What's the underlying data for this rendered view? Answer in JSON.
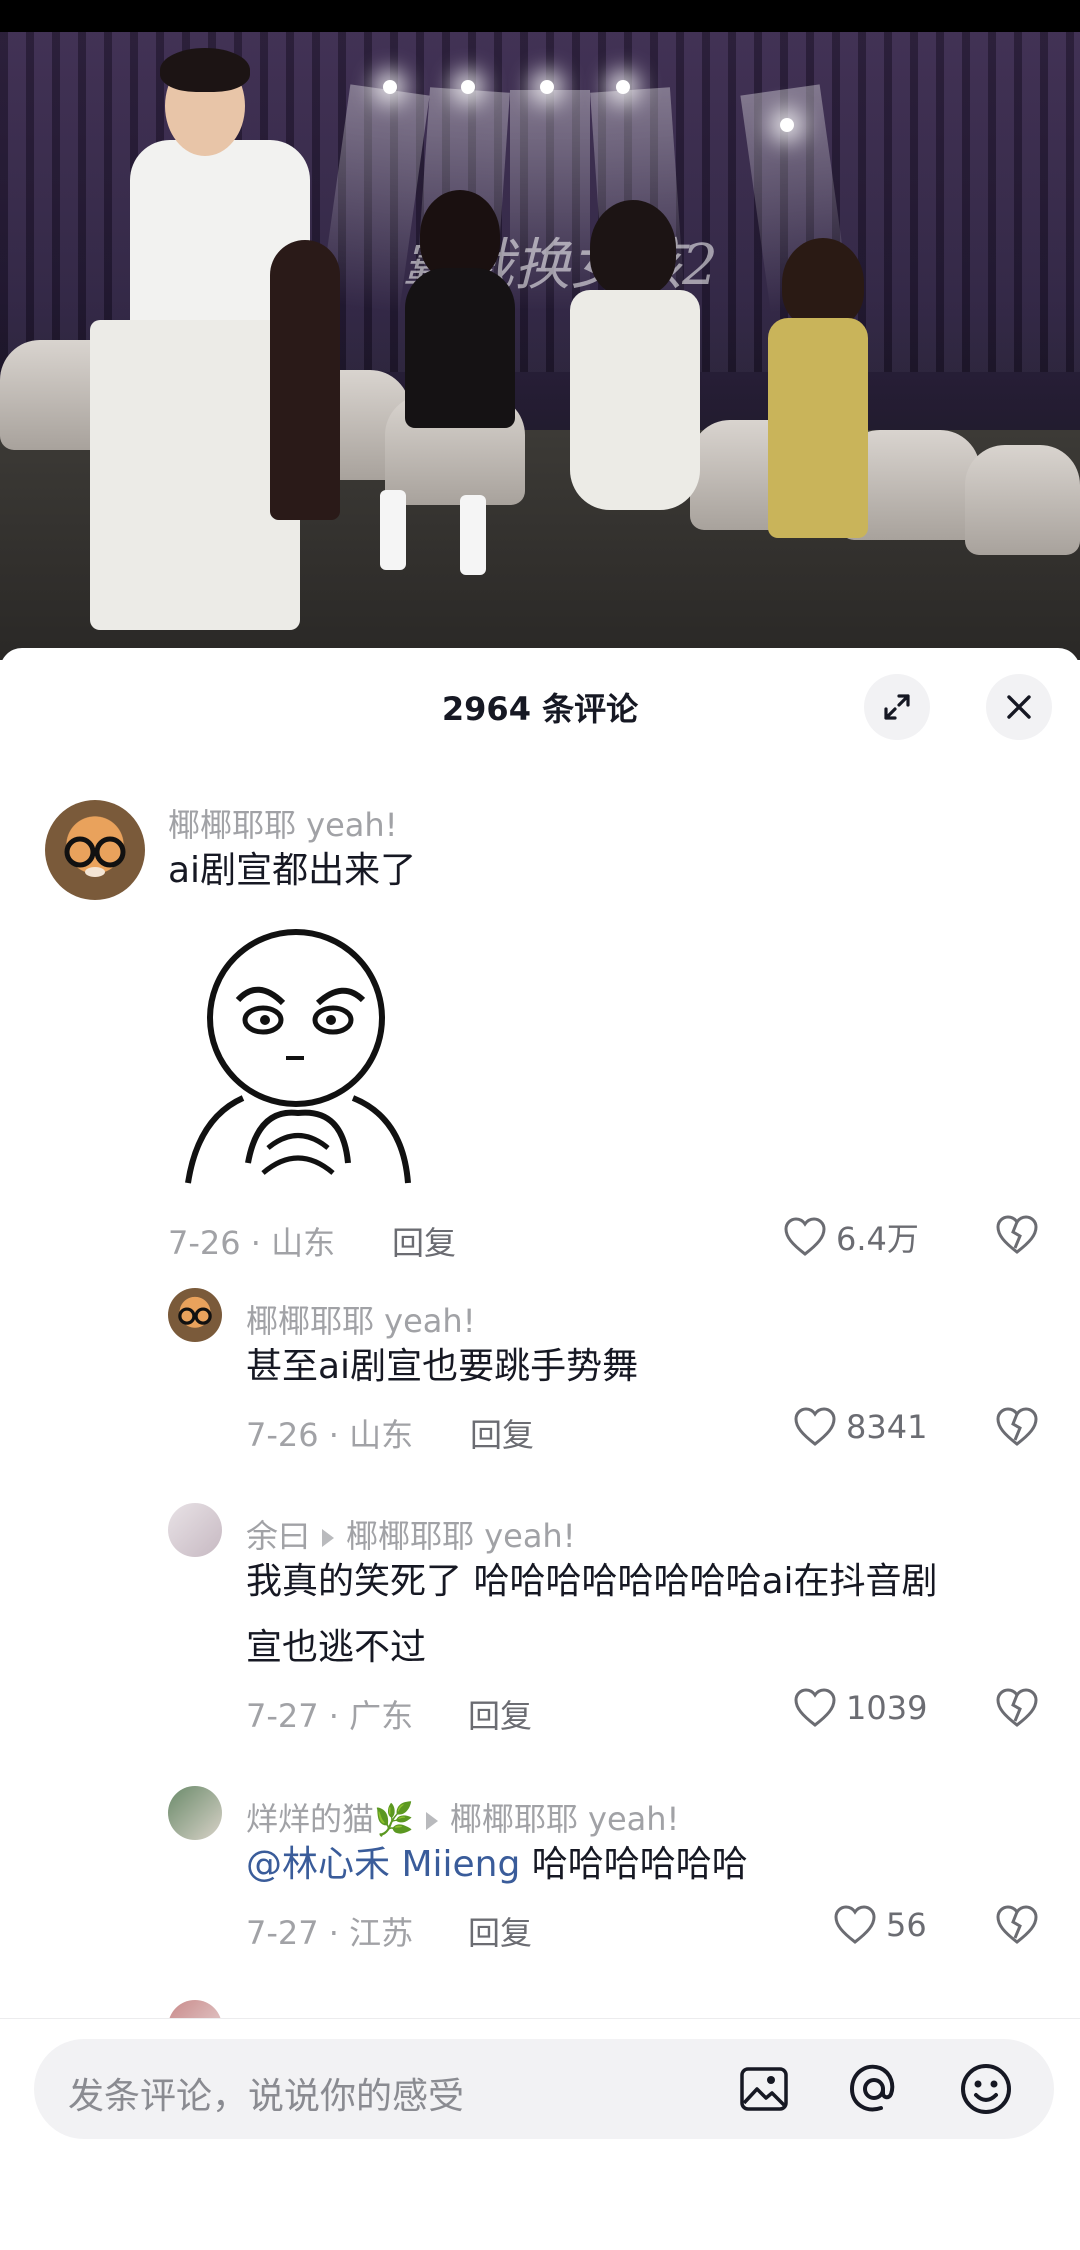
{
  "video": {
    "overlay_title": "霸裁换女孩2"
  },
  "sheet": {
    "comment_count": "2964 条评论"
  },
  "comments": [
    {
      "author": "椰椰耶耶 yeah!",
      "text": "ai剧宣都出来了",
      "date_loc": "7-26 · 山东",
      "reply": "回复",
      "likes": "6.4万",
      "has_sticker": true
    },
    {
      "author": "椰椰耶耶 yeah!",
      "text": "甚至ai剧宣也要跳手势舞",
      "date_loc": "7-26 · 山东",
      "reply": "回复",
      "likes": "8341"
    },
    {
      "author": "余曰",
      "reply_to": "椰椰耶耶 yeah!",
      "text_line1": "我真的笑死了 哈哈哈哈哈哈哈哈ai在抖音剧",
      "text_line2": "宣也逃不过",
      "date_loc": "7-27 · 广东",
      "reply": "回复",
      "likes": "1039"
    },
    {
      "author": "烊烊的猫🌿",
      "reply_to": "椰椰耶耶 yeah!",
      "mention": "@林心禾 Miieng",
      "text": " 哈哈哈哈哈哈",
      "date_loc": "7-27 · 江苏",
      "reply": "回复",
      "likes": "56"
    }
  ],
  "input": {
    "placeholder": "发条评论，说说你的感受"
  },
  "colors": {
    "text_primary": "#161823",
    "text_secondary": "#a1a2a6",
    "mention": "#3a5c9a",
    "input_bg": "#f2f2f4"
  }
}
